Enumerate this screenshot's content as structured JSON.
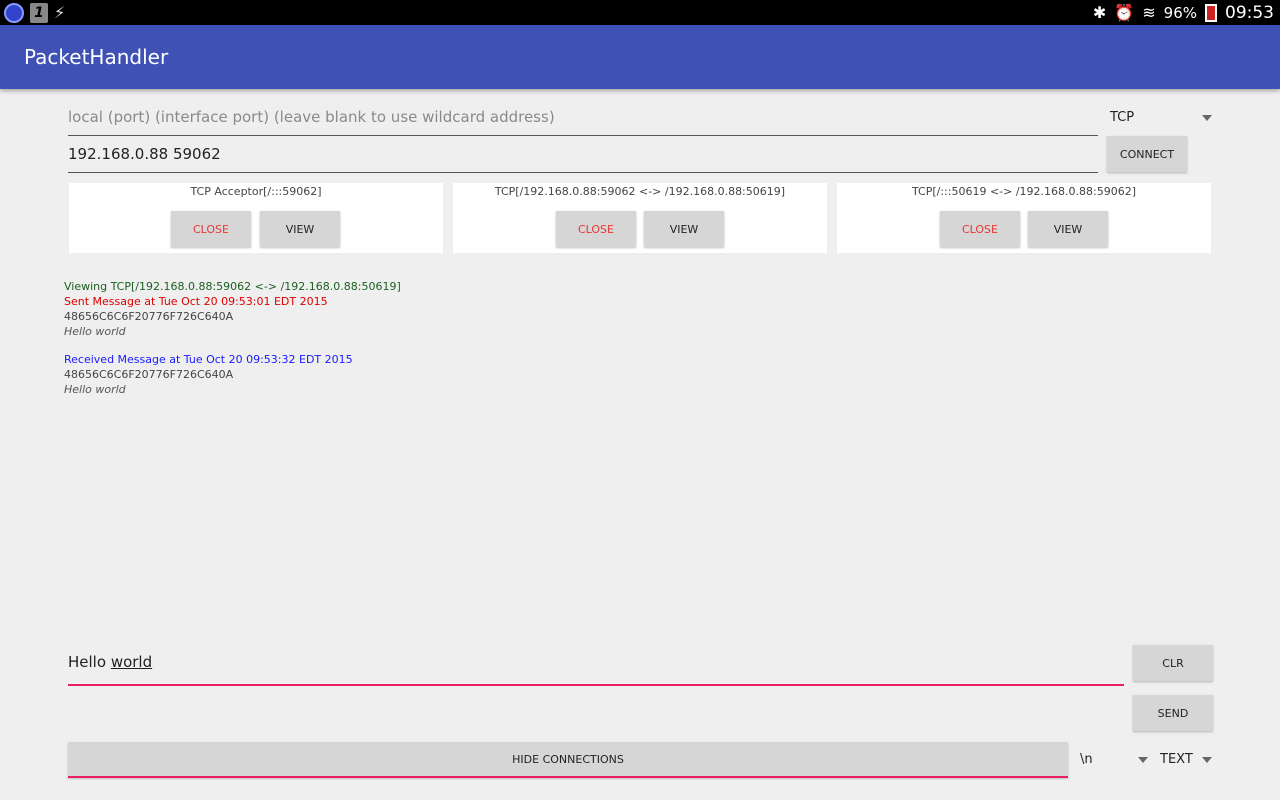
{
  "status_bar": {
    "battery": "96%",
    "time": "09:53",
    "icons": [
      "app-badge-icon",
      "one-icon",
      "bolt-icon",
      "bluetooth-icon",
      "alarm-icon",
      "wifi-icon",
      "battery-icon"
    ]
  },
  "app": {
    "title": "PacketHandler"
  },
  "local_field": {
    "placeholder": "local (port) (interface port) (leave blank to use wildcard address)"
  },
  "remote_field": {
    "value": "192.168.0.88 59062"
  },
  "protocol_spinner": {
    "selected": "TCP"
  },
  "connect_button": "CONNECT",
  "connections": [
    {
      "title": "TCP Acceptor[/:::59062]",
      "close": "CLOSE",
      "view": "VIEW"
    },
    {
      "title": "TCP[/192.168.0.88:59062 <-> /192.168.0.88:50619]",
      "close": "CLOSE",
      "view": "VIEW"
    },
    {
      "title": "TCP[/:::50619 <-> /192.168.0.88:59062]",
      "close": "CLOSE",
      "view": "VIEW"
    }
  ],
  "log": {
    "viewing": "Viewing TCP[/192.168.0.88:59062 <-> /192.168.0.88:50619]",
    "sent_header": "Sent Message at Tue Oct 20 09:53:01 EDT 2015",
    "sent_hex": "48656C6C6F20776F726C640A",
    "sent_text": "Hello world",
    "recv_header": "Received Message at Tue Oct 20 09:53:32 EDT 2015",
    "recv_hex": "48656C6C6F20776F726C640A",
    "recv_text": "Hello world"
  },
  "message_field": {
    "word1": "Hello",
    "word2": "world"
  },
  "clr_button": "CLR",
  "send_button": "SEND",
  "hide_connections_button": "HIDE CONNECTIONS",
  "line_ending_spinner": {
    "selected": "\\n"
  },
  "format_spinner": {
    "selected": "TEXT"
  },
  "colors": {
    "app_bar": "#3f51b5",
    "accent": "#e91e63",
    "close_red": "#e53935"
  }
}
